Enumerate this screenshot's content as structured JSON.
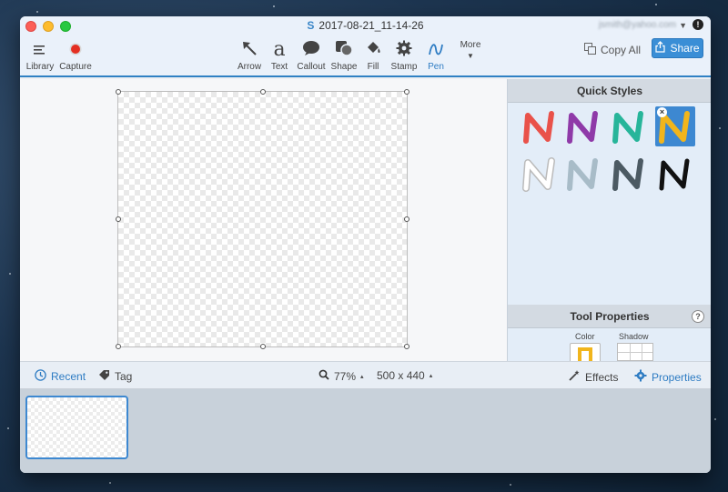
{
  "window": {
    "title": "2017-08-21_11-14-26",
    "account": "jsmith@yahoo.com"
  },
  "toolbar": {
    "left_tools": [
      {
        "label": "Library",
        "icon": "menu-lines-icon"
      },
      {
        "label": "Capture",
        "icon": "record-dot-icon"
      }
    ],
    "tools": [
      {
        "label": "Arrow",
        "icon": "arrow-icon"
      },
      {
        "label": "Text",
        "icon": "text-a-icon"
      },
      {
        "label": "Callout",
        "icon": "speech-bubble-icon"
      },
      {
        "label": "Shape",
        "icon": "shape-icon"
      },
      {
        "label": "Fill",
        "icon": "paint-bucket-icon"
      },
      {
        "label": "Stamp",
        "icon": "gear-stamp-icon"
      },
      {
        "label": "Pen",
        "icon": "pen-squiggle-icon"
      }
    ],
    "more_label": "More",
    "copy_all_label": "Copy All",
    "share_label": "Share"
  },
  "right_panel": {
    "quick_styles_title": "Quick Styles",
    "tool_properties_title": "Tool Properties",
    "color_label": "Color",
    "shadow_label": "Shadow",
    "styles": [
      {
        "color": "#e9524a",
        "selected": false
      },
      {
        "color": "#8f3aa8",
        "selected": false
      },
      {
        "color": "#27b59a",
        "selected": false
      },
      {
        "color": "#f1b51c",
        "selected": true
      },
      {
        "color": "#ffffff",
        "selected": false
      },
      {
        "color": "#a8bcc8",
        "selected": false
      },
      {
        "color": "#4c5a63",
        "selected": false
      },
      {
        "color": "#111111",
        "selected": false
      }
    ],
    "selected_color": "#f1b51c"
  },
  "statusbar": {
    "recent_label": "Recent",
    "tag_label": "Tag",
    "zoom": "77%",
    "dimensions": "500 x 440",
    "effects_label": "Effects",
    "properties_label": "Properties"
  },
  "colors": {
    "accent": "#3a8ed6",
    "toolbar_underline": "#2f81c4"
  }
}
